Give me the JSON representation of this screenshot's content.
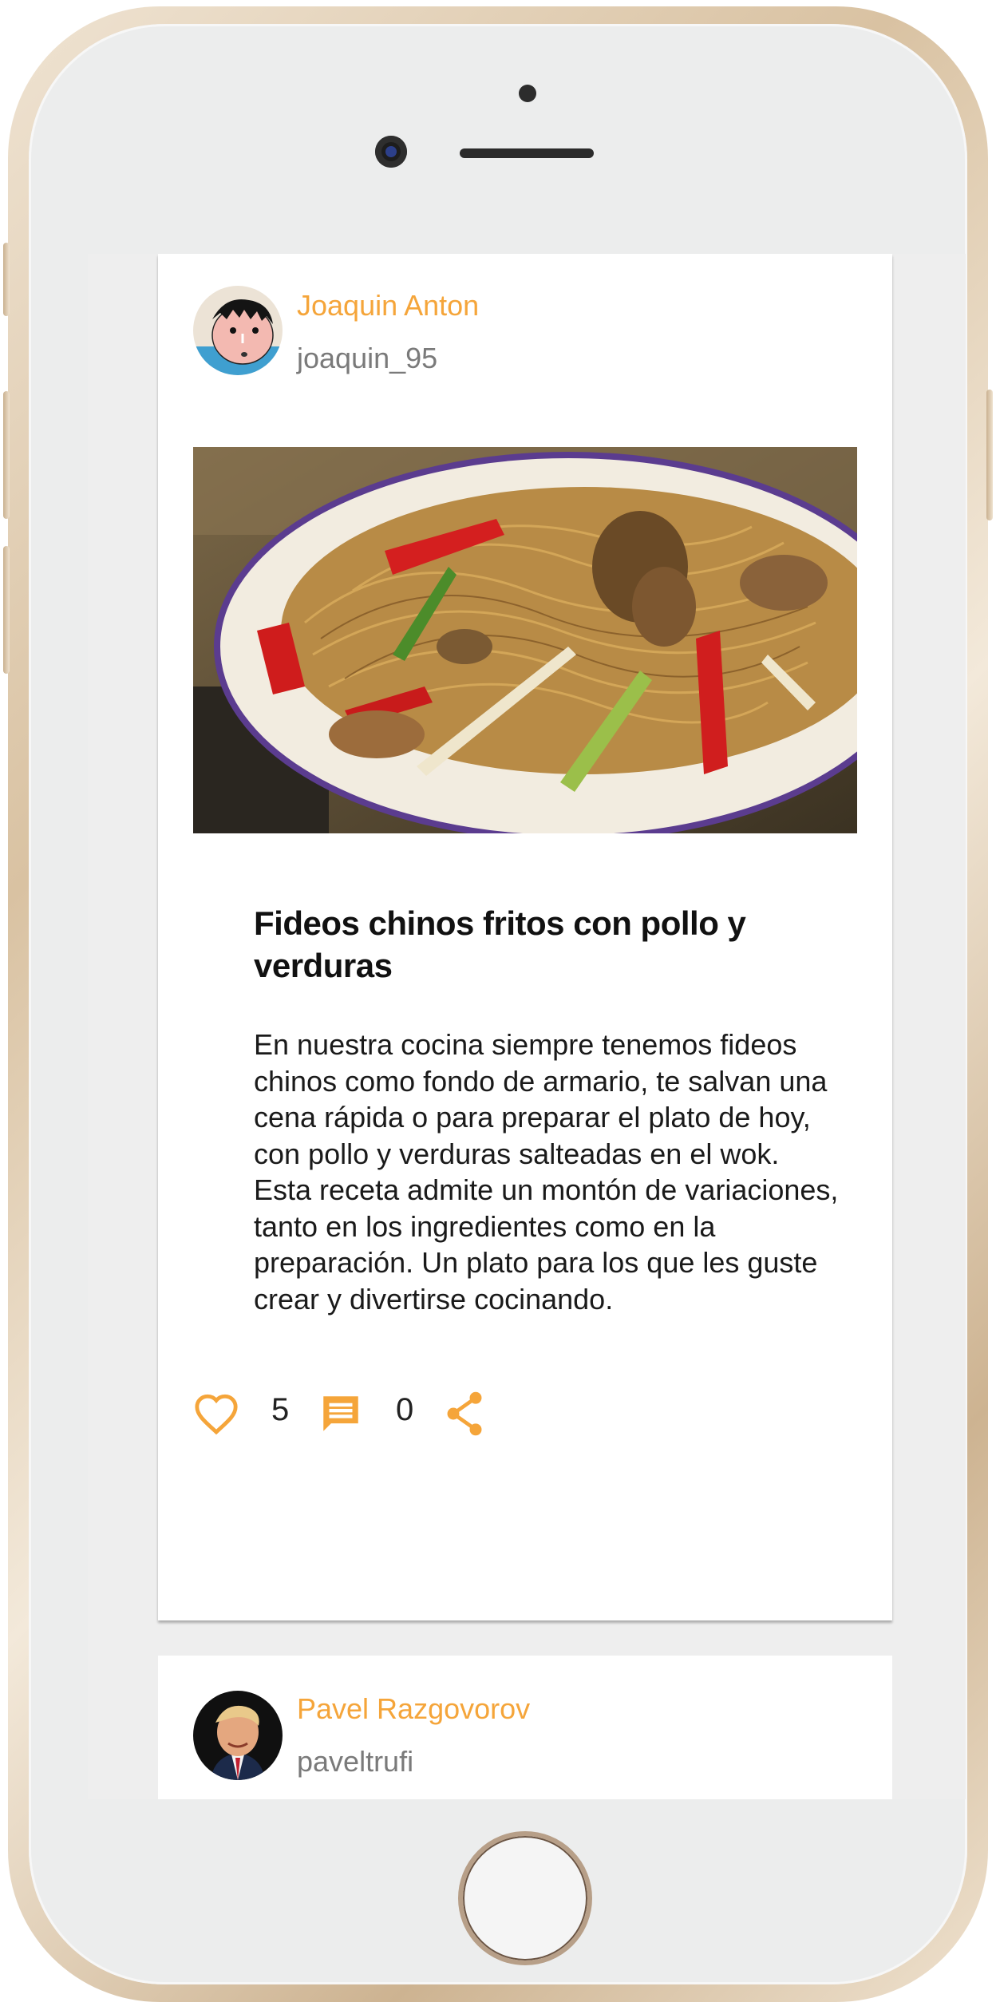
{
  "colors": {
    "accent": "#f5a53a",
    "handle": "#7a7a7a"
  },
  "posts": [
    {
      "author_name": "Joaquin Anton",
      "author_handle": "joaquin_95",
      "title": "Fideos chinos fritos con pollo y verduras",
      "body": "En nuestra cocina siempre tenemos fideos chinos como fondo de armario, te salvan una cena rápida o para preparar el plato de hoy, con pollo y verduras salteadas en el wok. Esta receta admite un montón de variaciones, tanto en los ingredientes como en la preparación. Un plato para los que les guste crear y divertirse cocinando.",
      "likes": "5",
      "comments": "0",
      "icons": {
        "like": "heart-outline-icon",
        "comment": "comment-icon",
        "share": "share-icon"
      }
    },
    {
      "author_name": "Pavel Razgovorov",
      "author_handle": "paveltrufi"
    }
  ]
}
